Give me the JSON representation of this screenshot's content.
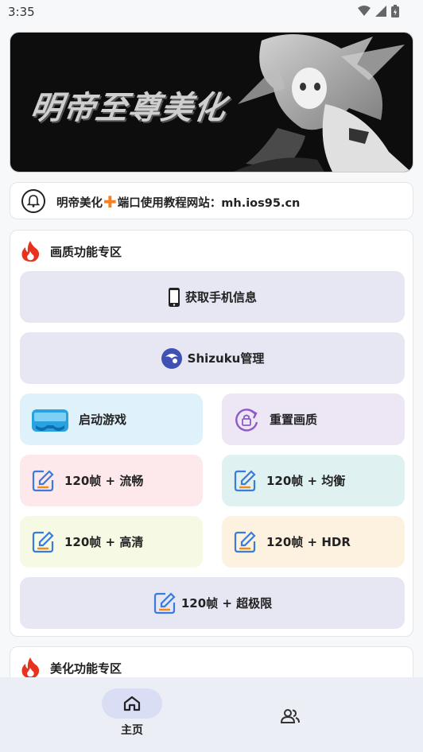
{
  "status_bar": {
    "time": "3:35"
  },
  "banner": {
    "title": "明帝至尊美化"
  },
  "notice": {
    "prefix": "明帝美化",
    "plus": "✚",
    "suffix": "端口使用教程网站：mh.ios95.cn"
  },
  "section_quality": {
    "title": "画质功能专区",
    "buttons": {
      "get_phone_info": "获取手机信息",
      "shizuku": "Shizuku管理",
      "start_game": "启动游戏",
      "reset_quality": "重置画质",
      "fps_smooth": "120帧 + 流畅",
      "fps_balanced": "120帧 + 均衡",
      "fps_hd": "120帧 + 高清",
      "fps_hdr": "120帧 + HDR",
      "fps_ultra": "120帧 + 超极限"
    }
  },
  "section_beautify": {
    "title": "美化功能专区"
  },
  "bottom_nav": {
    "home_label": "主页"
  },
  "colors": {
    "start_game_bg": "#dff1fb",
    "reset_bg": "#ece6f5",
    "smooth_bg": "#fde8ec",
    "balanced_bg": "#dff1f0",
    "hd_bg": "#f6f9e3",
    "hdr_bg": "#fdf1df",
    "full_bg": "#e6e7f3"
  }
}
